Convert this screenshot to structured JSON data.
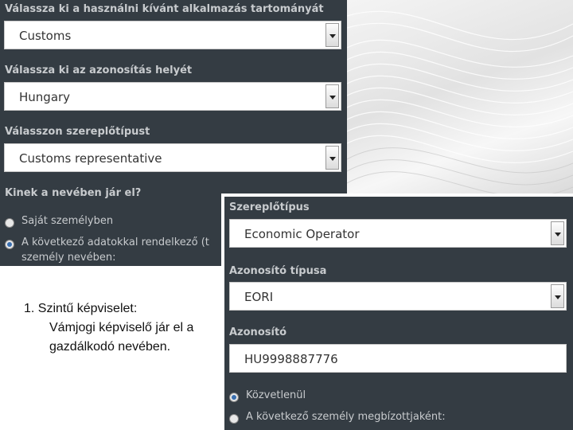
{
  "panel_a": {
    "domain_label": "Válassza ki a használni kívánt alkalmazás tartományát",
    "domain_value": "Customs",
    "location_label": "Válassza ki az azonosítás helyét",
    "location_value": "Hungary",
    "actor_type_label": "Válasszon szereplőtípust",
    "actor_type_value": "Customs representative",
    "on_behalf_label": "Kinek a nevében jár el?",
    "option_own": "Saját személyben",
    "option_other_line1": "A következő adatokkal rendelkező (t",
    "option_other_line2": "személy nevében:"
  },
  "panel_b": {
    "actor_type_label": "Szereplőtípus",
    "actor_type_value": "Economic Operator",
    "id_type_label": "Azonosító típusa",
    "id_type_value": "EORI",
    "id_label": "Azonosító",
    "id_value": "HU9998887776",
    "option_direct": "Közvetlenül",
    "option_proxy": "A következő személy megbízottjaként:"
  },
  "note": {
    "line1": "1. Szintű képviselet:",
    "line2": "Vámjogi képviselő jár el a",
    "line3": "gazdálkodó nevében."
  }
}
